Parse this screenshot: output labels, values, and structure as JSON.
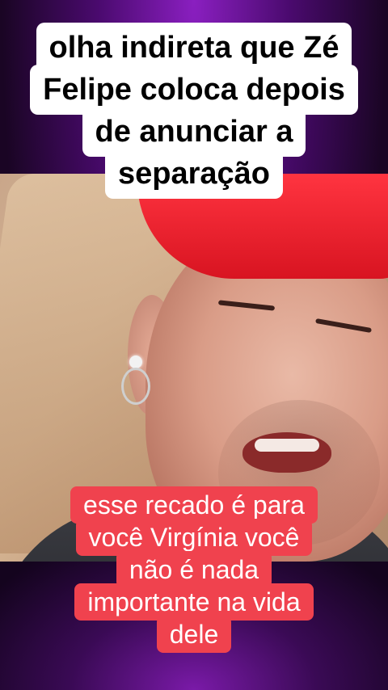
{
  "headline": {
    "lines": [
      "olha indireta que Zé",
      "Felipe coloca depois",
      "de anunciar a",
      "separação"
    ]
  },
  "subtitle": {
    "lines": [
      "esse recado é para",
      "você Virgínia você",
      "não é nada",
      "importante na vida",
      "dele"
    ]
  },
  "colors": {
    "headline_bg": "#ffffff",
    "subtitle_bg": "#f0424e",
    "background": "#4a0a6e"
  }
}
